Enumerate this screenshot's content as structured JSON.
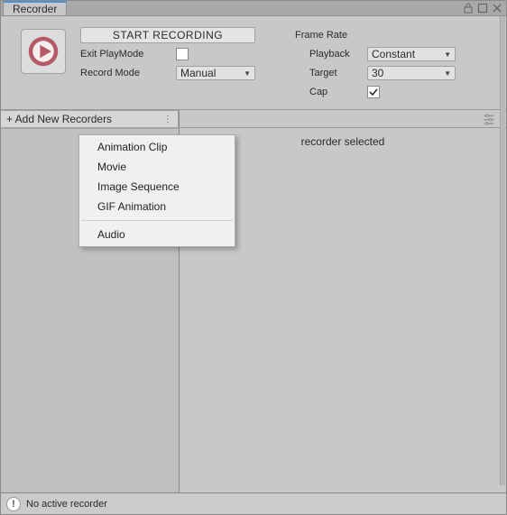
{
  "tab": {
    "title": "Recorder"
  },
  "controls": {
    "start_label": "START RECORDING",
    "exit_playmode_label": "Exit PlayMode",
    "exit_playmode_checked": false,
    "record_mode_label": "Record Mode",
    "record_mode_value": "Manual"
  },
  "frame_rate": {
    "heading": "Frame Rate",
    "playback_label": "Playback",
    "playback_value": "Constant",
    "target_label": "Target",
    "target_value": "30",
    "cap_label": "Cap",
    "cap_checked": true
  },
  "sidebar": {
    "add_button_label": "+ Add New Recorders"
  },
  "main": {
    "empty_message": "recorder selected"
  },
  "popup_items": [
    "Animation Clip",
    "Movie",
    "Image Sequence",
    "GIF Animation"
  ],
  "popup_items2": [
    "Audio"
  ],
  "statusbar": {
    "message": "No active recorder"
  }
}
